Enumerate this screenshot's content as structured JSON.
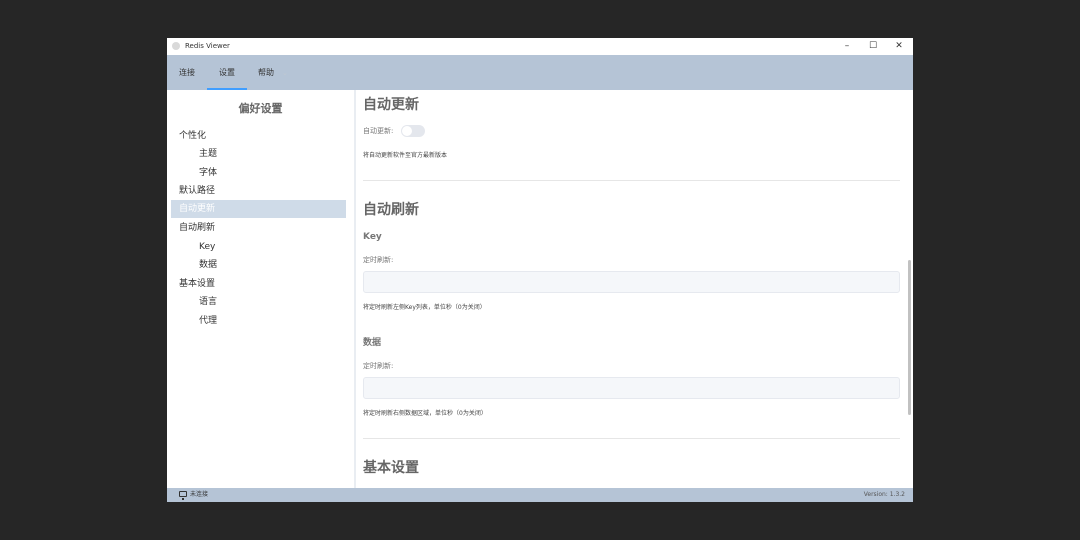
{
  "window": {
    "title": "Redis Viewer",
    "minimize": "–",
    "maximize": "☐",
    "close": "✕"
  },
  "menu": {
    "items": [
      "连接",
      "设置",
      "帮助"
    ],
    "active": "设置",
    "chevron": "⌄"
  },
  "sidebar": {
    "title": "偏好设置",
    "items": [
      {
        "label": "个性化",
        "level": 0
      },
      {
        "label": "主题",
        "level": 1
      },
      {
        "label": "字体",
        "level": 1
      },
      {
        "label": "默认路径",
        "level": 0
      },
      {
        "label": "自动更新",
        "level": 0,
        "active": true
      },
      {
        "label": "自动刷新",
        "level": 0
      },
      {
        "label": "Key",
        "level": 1
      },
      {
        "label": "数据",
        "level": 1
      },
      {
        "label": "基本设置",
        "level": 0
      },
      {
        "label": "语言",
        "level": 1
      },
      {
        "label": "代理",
        "level": 1
      }
    ]
  },
  "content": {
    "auto_update": {
      "heading": "自动更新",
      "toggle_label": "自动更新:",
      "toggle_on": false,
      "hint": "将自动更新软件至官方最新版本"
    },
    "auto_refresh": {
      "heading": "自动刷新",
      "key": {
        "heading": "Key",
        "label": "定时刷新:",
        "value": "",
        "hint": "将定时刷新左侧Key列表，单位秒（0为关闭）"
      },
      "data": {
        "heading": "数据",
        "label": "定时刷新:",
        "value": "",
        "hint": "将定时刷新右侧数据区域，单位秒（0为关闭）"
      }
    },
    "basic": {
      "heading": "基本设置"
    }
  },
  "status": {
    "connection": "未连接",
    "version": "Version: 1.3.2"
  },
  "colors": {
    "menubar": "#b5c4d6",
    "accent": "#409eff",
    "active_item": "#cfdbe8"
  }
}
